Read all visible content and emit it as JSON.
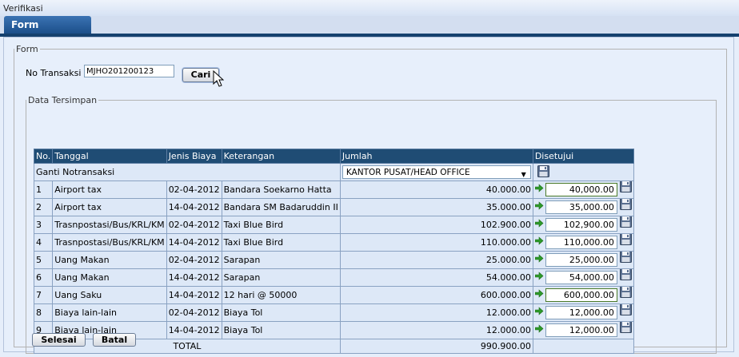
{
  "window": {
    "title": "Verifikasi"
  },
  "tabs": [
    {
      "label": "Form"
    }
  ],
  "form": {
    "legend": "Form",
    "no_transaksi_label": "No Transaksi",
    "no_transaksi_value": "MJHO201200123",
    "search_button": "Cari"
  },
  "data_section": {
    "legend": "Data Tersimpan",
    "columns": [
      "No.",
      "Tanggal",
      "Jenis Biaya",
      "Keterangan",
      "Jumlah",
      "Disetujui"
    ],
    "ganti_label": "Ganti Notransaksi",
    "ganti_selected": "KANTOR PUSAT/HEAD OFFICE",
    "rows": [
      {
        "no": "1",
        "tanggal": "Airport tax",
        "jenis": "02-04-2012",
        "keterangan": "Bandara Soekarno Hatta",
        "jumlah": "40.000.00",
        "disetujui": "40,000.00"
      },
      {
        "no": "2",
        "tanggal": "Airport tax",
        "jenis": "14-04-2012",
        "keterangan": "Bandara SM Badaruddin II",
        "jumlah": "35.000.00",
        "disetujui": "35,000.00"
      },
      {
        "no": "3",
        "tanggal": "Trasnpostasi/Bus/KRL/KM",
        "jenis": "02-04-2012",
        "keterangan": "Taxi Blue Bird",
        "jumlah": "102.900.00",
        "disetujui": "102,900.00"
      },
      {
        "no": "4",
        "tanggal": "Trasnpostasi/Bus/KRL/KM",
        "jenis": "14-04-2012",
        "keterangan": "Taxi Blue Bird",
        "jumlah": "110.000.00",
        "disetujui": "110,000.00"
      },
      {
        "no": "5",
        "tanggal": "Uang Makan",
        "jenis": "02-04-2012",
        "keterangan": "Sarapan",
        "jumlah": "25.000.00",
        "disetujui": "25,000.00"
      },
      {
        "no": "6",
        "tanggal": "Uang Makan",
        "jenis": "14-04-2012",
        "keterangan": "Sarapan",
        "jumlah": "54.000.00",
        "disetujui": "54,000.00"
      },
      {
        "no": "7",
        "tanggal": "Uang Saku",
        "jenis": "14-04-2012",
        "keterangan": "12 hari @ 50000",
        "jumlah": "600.000.00",
        "disetujui": "600,000.00"
      },
      {
        "no": "8",
        "tanggal": "Biaya lain-lain",
        "jenis": "02-04-2012",
        "keterangan": "Biaya Tol",
        "jumlah": "12.000.00",
        "disetujui": "12,000.00"
      },
      {
        "no": "9",
        "tanggal": "Biaya lain-lain",
        "jenis": "14-04-2012",
        "keterangan": "Biaya Tol",
        "jumlah": "12.000.00",
        "disetujui": "12,000.00"
      }
    ],
    "total_label": "TOTAL",
    "total_value": "990.900.00"
  },
  "actions": {
    "finish": "Selesai",
    "cancel": "Batal"
  },
  "icons": {
    "save": "floppy-disk-icon",
    "copy": "green-arrow-icon",
    "dropdown": "chevron-down-icon"
  },
  "colors": {
    "header_bg": "#1f4c74",
    "tab_bg": "#2a5f9e",
    "row_bg": "#dde8f7"
  }
}
